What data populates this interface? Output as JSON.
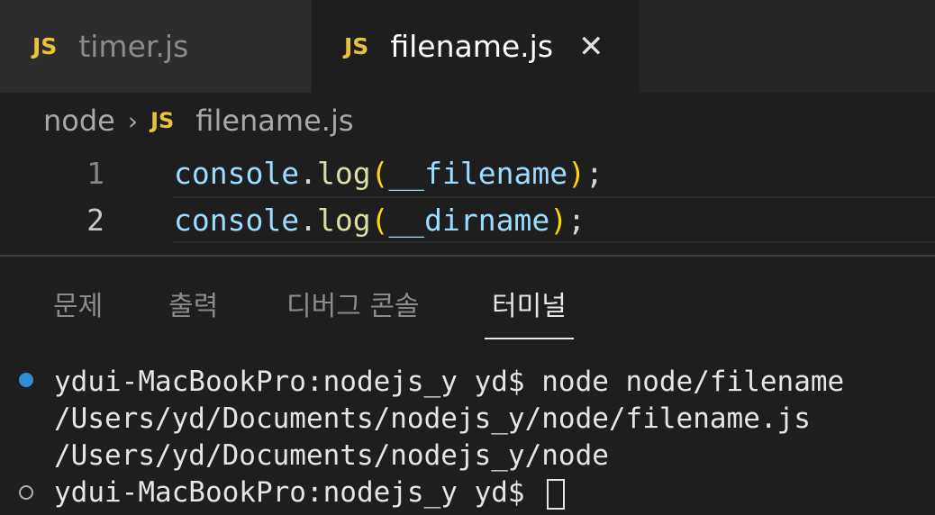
{
  "tabs": [
    {
      "icon": "JS",
      "label": "timer.js",
      "active": false
    },
    {
      "icon": "JS",
      "label": "filename.js",
      "active": true,
      "close": "✕"
    }
  ],
  "breadcrumb": {
    "folder": "node",
    "separator": "›",
    "icon": "JS",
    "file": "filename.js"
  },
  "editor": {
    "lines": [
      {
        "num": "1",
        "obj": "console",
        "dot": ".",
        "fn": "log",
        "open": "(",
        "arg": "__filename",
        "close": ")",
        "semi": ";"
      },
      {
        "num": "2",
        "obj": "console",
        "dot": ".",
        "fn": "log",
        "open": "(",
        "arg": "__dirname",
        "close": ")",
        "semi": ";"
      }
    ]
  },
  "panel": {
    "tabs": [
      "문제",
      "출력",
      "디버그 콘솔",
      "터미널"
    ],
    "active_tab": "터미널"
  },
  "terminal": {
    "lines": [
      "ydui-MacBookPro:nodejs_y yd$ node node/filename",
      "/Users/yd/Documents/nodejs_y/node/filename.js",
      "/Users/yd/Documents/nodejs_y/node",
      "ydui-MacBookPro:nodejs_y yd$ "
    ]
  },
  "colors": {
    "js_icon": "#e8c33b",
    "accent_dot": "#2f8fd4",
    "background": "#1e1e1e"
  }
}
